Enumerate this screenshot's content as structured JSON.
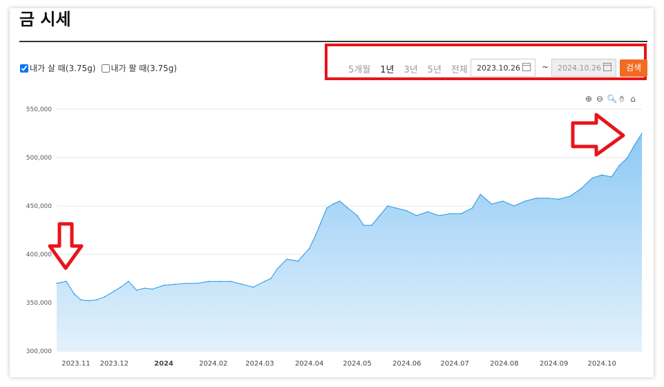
{
  "page": {
    "title": "금 시세"
  },
  "legend": {
    "buy_label": "내가 살 때(3.75g)",
    "buy_checked": true,
    "sell_label": "내가 팔 때(3.75g)",
    "sell_checked": false
  },
  "periods": [
    "5개월",
    "1년",
    "3년",
    "5년",
    "전체"
  ],
  "active_period": "1년",
  "date_range": {
    "start": "2023.10.26",
    "separator": "~",
    "end": "2024.10.26"
  },
  "search_label": "검색",
  "zoom_tools": [
    "zoom-in-icon",
    "zoom-out-icon",
    "magnifier-icon",
    "hand-icon",
    "home-icon"
  ],
  "colors": {
    "line": "#2196e6",
    "area_top": "#8ec9f5",
    "area_bottom": "#e3f1fc",
    "accent": "#f26b21",
    "annotation": "#e8141b"
  },
  "chart_data": {
    "type": "area",
    "ylim": [
      300000,
      550000
    ],
    "yticks": [
      "550,000",
      "500,000",
      "450,000",
      "400,000",
      "350,000",
      "300,000"
    ],
    "ytick_values": [
      550000,
      500000,
      450000,
      400000,
      350000,
      300000
    ],
    "xticks": [
      "2023.11",
      "2023.12",
      "2024",
      "2024.02",
      "2024.03",
      "2024.04",
      "2024.05",
      "2024.06",
      "2024.07",
      "2024.08",
      "2024.09",
      "2024.10"
    ],
    "x": [
      "2023-10-26",
      "2023-11-01",
      "2023-11-06",
      "2023-11-10",
      "2023-11-15",
      "2023-11-20",
      "2023-11-25",
      "2023-12-01",
      "2023-12-05",
      "2023-12-10",
      "2023-12-15",
      "2023-12-20",
      "2023-12-25",
      "2024-01-01",
      "2024-01-08",
      "2024-01-15",
      "2024-01-22",
      "2024-01-29",
      "2024-02-05",
      "2024-02-12",
      "2024-02-19",
      "2024-02-26",
      "2024-03-04",
      "2024-03-08",
      "2024-03-12",
      "2024-03-18",
      "2024-03-25",
      "2024-04-01",
      "2024-04-05",
      "2024-04-08",
      "2024-04-12",
      "2024-04-16",
      "2024-04-20",
      "2024-04-25",
      "2024-05-01",
      "2024-05-05",
      "2024-05-10",
      "2024-05-15",
      "2024-05-20",
      "2024-05-25",
      "2024-06-01",
      "2024-06-07",
      "2024-06-14",
      "2024-06-21",
      "2024-06-28",
      "2024-07-05",
      "2024-07-12",
      "2024-07-17",
      "2024-07-24",
      "2024-07-31",
      "2024-08-07",
      "2024-08-14",
      "2024-08-21",
      "2024-08-28",
      "2024-09-04",
      "2024-09-11",
      "2024-09-18",
      "2024-09-25",
      "2024-10-01",
      "2024-10-07",
      "2024-10-12",
      "2024-10-17",
      "2024-10-21",
      "2024-10-26"
    ],
    "values": [
      370000,
      372000,
      359000,
      353000,
      352000,
      353000,
      356000,
      362000,
      366000,
      372000,
      363000,
      365000,
      364000,
      368000,
      369000,
      370000,
      370000,
      372000,
      372000,
      372000,
      369000,
      366000,
      372000,
      375000,
      385000,
      395000,
      393000,
      406000,
      420000,
      432000,
      448000,
      452000,
      455000,
      448000,
      440000,
      430000,
      430000,
      440000,
      450000,
      448000,
      445000,
      440000,
      444000,
      440000,
      442000,
      442000,
      448000,
      462000,
      452000,
      455000,
      450000,
      455000,
      458000,
      458000,
      457000,
      460000,
      468000,
      479000,
      482000,
      480000,
      492000,
      500000,
      512000,
      525000
    ]
  }
}
